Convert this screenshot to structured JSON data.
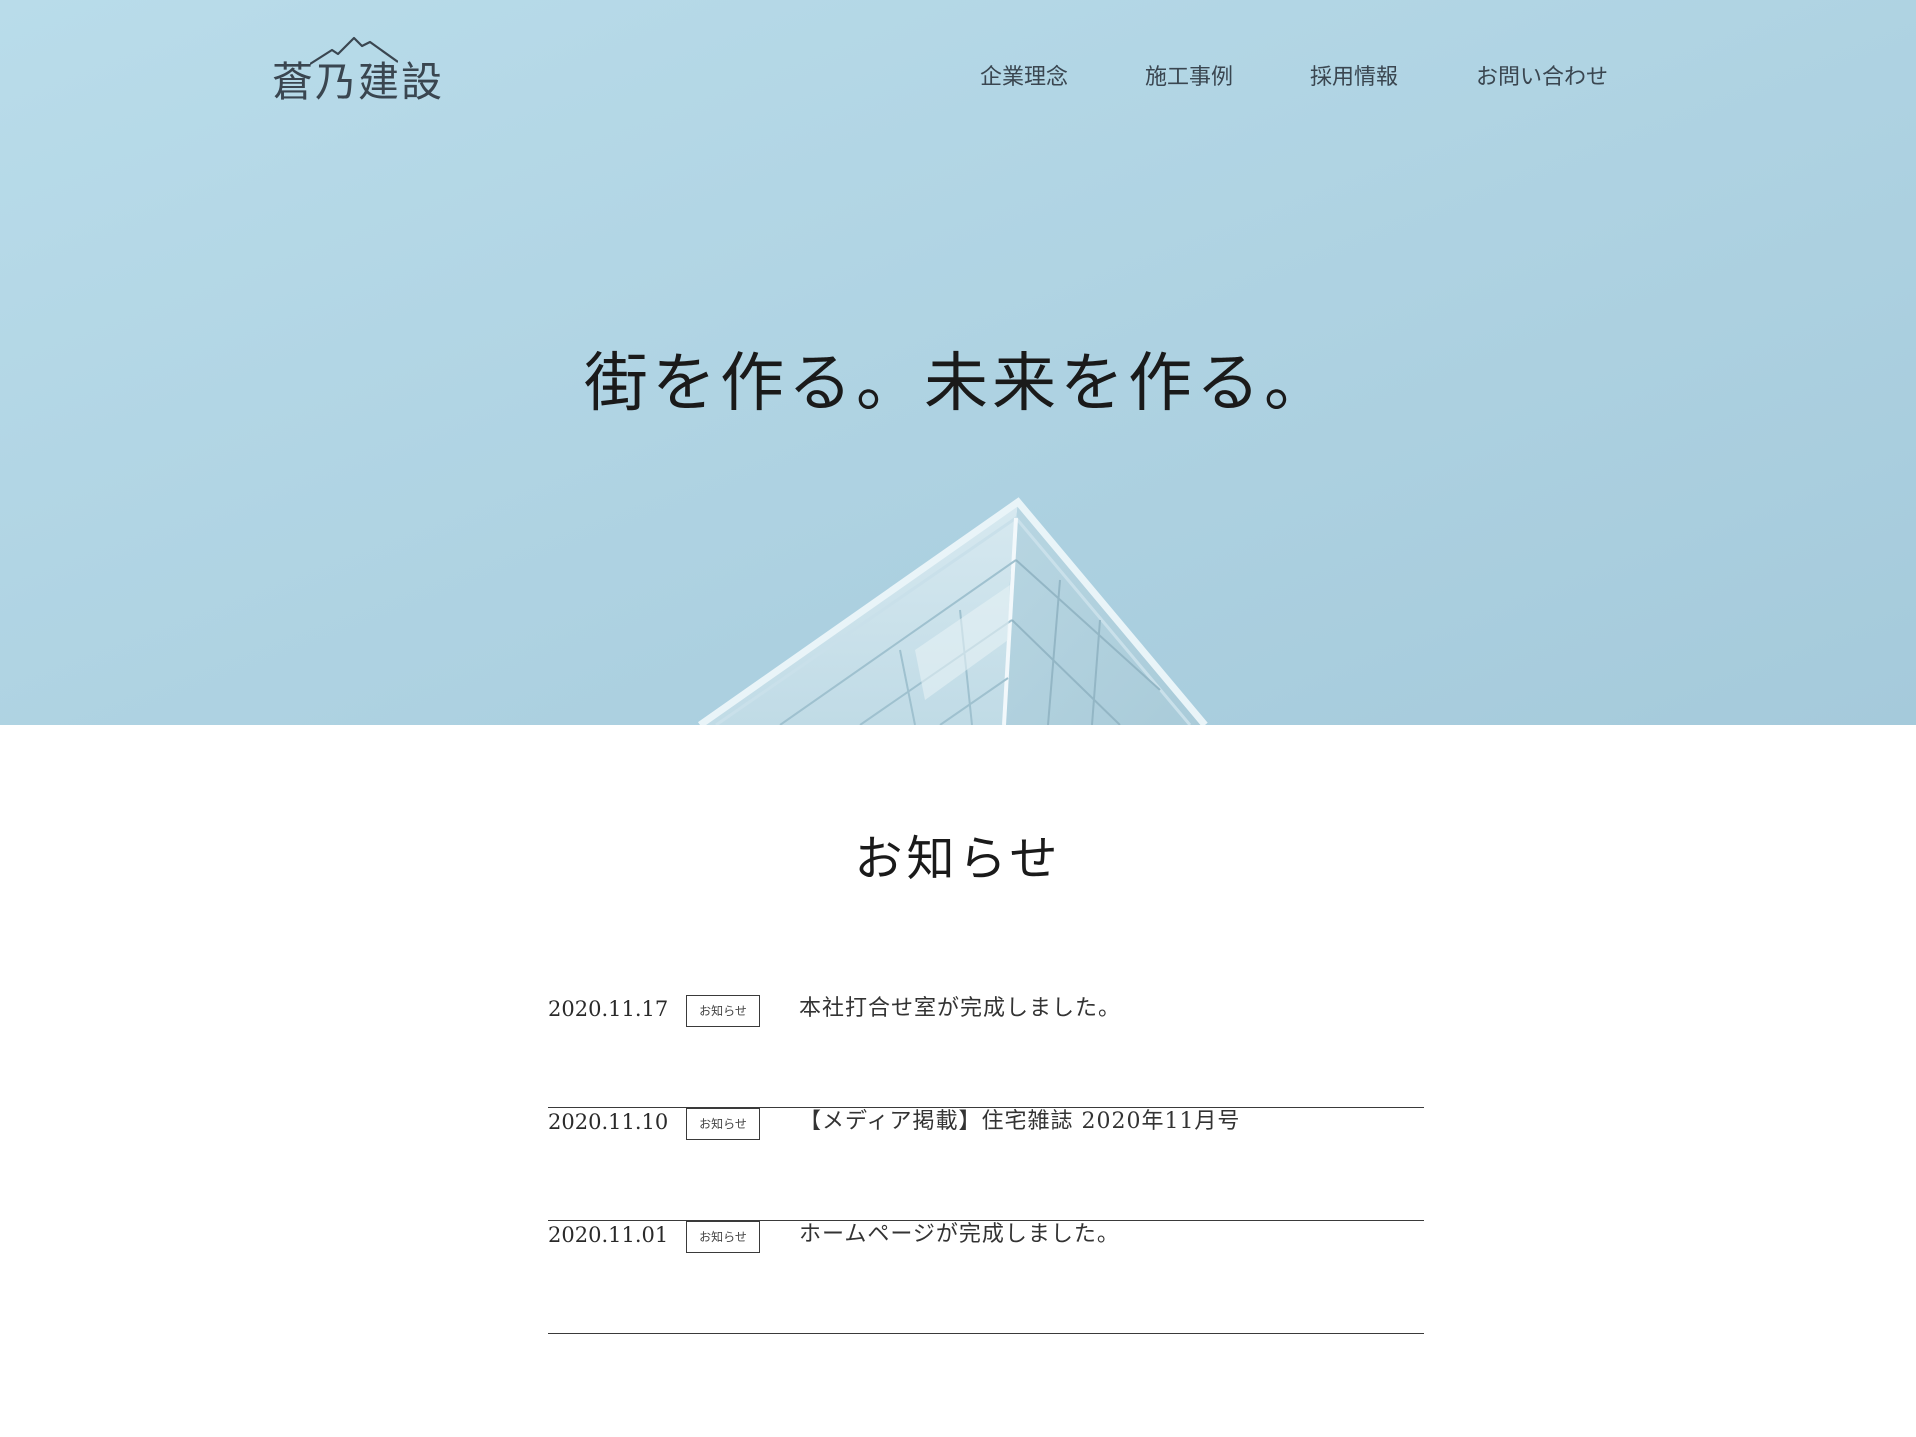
{
  "header": {
    "logo_text": "蒼乃建設",
    "nav": [
      "企業理念",
      "施工事例",
      "採用情報",
      "お問い合わせ"
    ]
  },
  "hero": {
    "headline": "街を作る。未来を作る。"
  },
  "news": {
    "title": "お知らせ",
    "items": [
      {
        "date": "2020.11.17",
        "tag": "お知らせ",
        "text": "本社打合せ室が完成しました。"
      },
      {
        "date": "2020.11.10",
        "tag": "お知らせ",
        "text": "【メディア掲載】住宅雑誌 2020年11月号"
      },
      {
        "date": "2020.11.01",
        "tag": "お知らせ",
        "text": "ホームページが完成しました。"
      }
    ]
  },
  "colors": {
    "sky_light": "#b9dcea",
    "sky_dark": "#a6cbdb",
    "text_dark": "#3a4650"
  }
}
